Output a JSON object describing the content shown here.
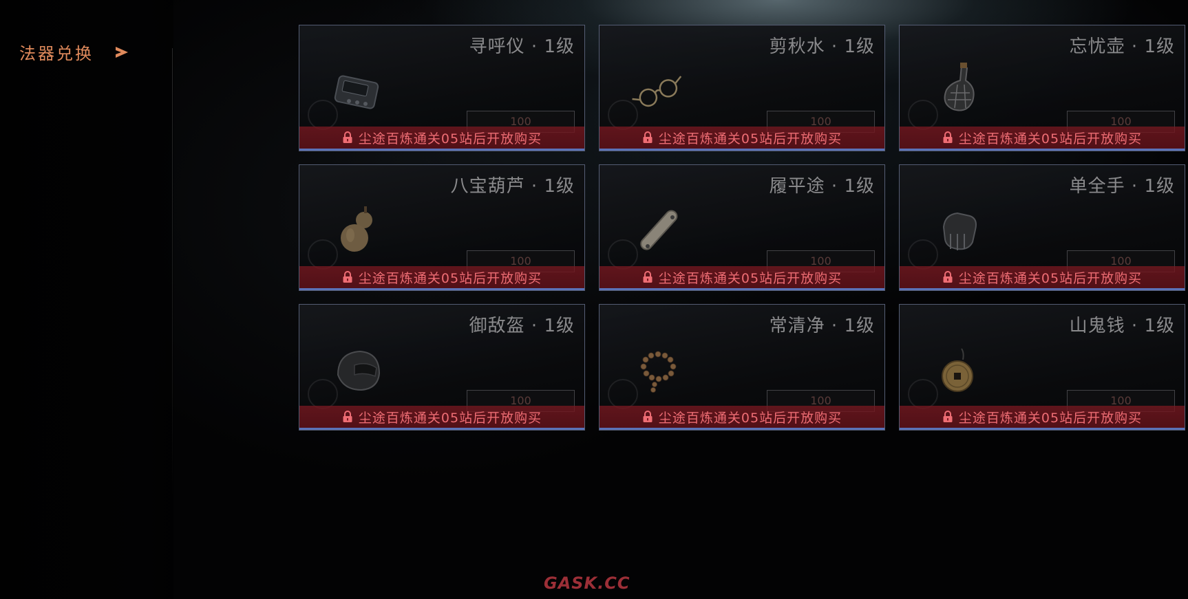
{
  "sidebar": {
    "label": "法器兑换",
    "arrow_icon": "triangle-arrow-right-icon"
  },
  "cards": [
    {
      "name": "寻呼仪 · 1级",
      "item_icon": "pager-icon",
      "price": "100",
      "locked": true,
      "lock_text": "尘途百炼通关05站后开放购买"
    },
    {
      "name": "剪秋水 · 1级",
      "item_icon": "glasses-icon",
      "price": "100",
      "locked": true,
      "lock_text": "尘途百炼通关05站后开放购买"
    },
    {
      "name": "忘忧壶 · 1级",
      "item_icon": "flask-icon",
      "price": "100",
      "locked": true,
      "lock_text": "尘途百炼通关05站后开放购买"
    },
    {
      "name": "八宝葫芦 · 1级",
      "item_icon": "gourd-icon",
      "price": "100",
      "locked": true,
      "lock_text": "尘途百炼通关05站后开放购买"
    },
    {
      "name": "履平途 · 1级",
      "item_icon": "skateboard-icon",
      "price": "100",
      "locked": true,
      "lock_text": "尘途百炼通关05站后开放购买"
    },
    {
      "name": "单全手 · 1级",
      "item_icon": "glove-icon",
      "price": "100",
      "locked": true,
      "lock_text": "尘途百炼通关05站后开放购买"
    },
    {
      "name": "御敌盔 · 1级",
      "item_icon": "helmet-icon",
      "price": "100",
      "locked": true,
      "lock_text": "尘途百炼通关05站后开放购买"
    },
    {
      "name": "常清净 · 1级",
      "item_icon": "prayer-beads-icon",
      "price": "100",
      "locked": true,
      "lock_text": "尘途百炼通关05站后开放购买"
    },
    {
      "name": "山鬼钱 · 1级",
      "item_icon": "coin-pendant-icon",
      "price": "100",
      "locked": true,
      "lock_text": "尘途百炼通关05站后开放购买"
    }
  ],
  "colors": {
    "accent": "#e08a5c",
    "lock_bar": "#7a1820",
    "lock_text": "#ee6d74",
    "card_underline": "#5a72b8"
  },
  "watermark": "GASK.CC"
}
